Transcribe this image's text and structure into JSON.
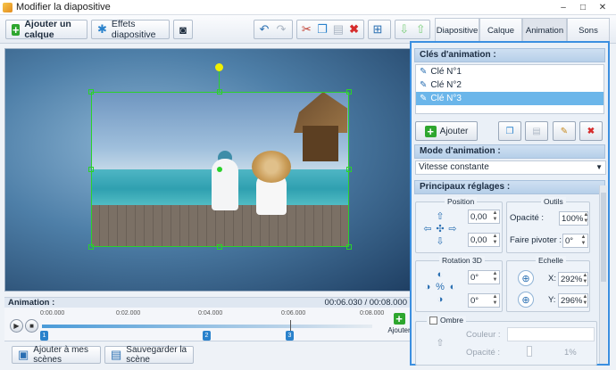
{
  "window": {
    "title": "Modifier la diapositive",
    "minimize": "–",
    "maximize": "□",
    "close": "✕"
  },
  "toolbar": {
    "add_layer": "Ajouter un calque",
    "slide_effects": "Effets diapositive"
  },
  "tabs": [
    "Diapositive",
    "Calque",
    "Animation",
    "Sons"
  ],
  "active_tab": "Animation",
  "timeline": {
    "section_label": "Animation :",
    "time_display": "00:06.030 / 00:08.000",
    "ticks": [
      "0:00.000",
      "0:02.000",
      "0:04.000",
      "0:06.000",
      "0:08.000"
    ],
    "keys": [
      "1",
      "2",
      "3"
    ],
    "add_label": "Ajouter"
  },
  "bottom": {
    "add_to_scenes": "Ajouter à mes scènes",
    "save_scene": "Sauvegarder la scène"
  },
  "panel": {
    "keyframes_title": "Clés d'animation :",
    "keyframes": [
      {
        "label": "Clé N°1",
        "selected": false
      },
      {
        "label": "Clé N°2",
        "selected": false
      },
      {
        "label": "Clé N°3",
        "selected": true
      }
    ],
    "add_button": "Ajouter",
    "mode_title": "Mode d'animation :",
    "mode_value": "Vitesse constante",
    "settings_title": "Principaux réglages :",
    "position_label": "Position",
    "position_x": "0,00",
    "position_y": "0,00",
    "tools_label": "Outils",
    "opacity_label": "Opacité :",
    "opacity_value": "100%",
    "rotate_label": "Faire pivoter :",
    "rotate_value": "0°",
    "rotation3d_label": "Rotation 3D",
    "rot3d_x": "0°",
    "rot3d_y": "0°",
    "scale_label": "Echelle",
    "scale_x_label": "X:",
    "scale_x": "292%",
    "scale_y_label": "Y:",
    "scale_y": "296%",
    "shadow_label": "Ombre",
    "shadow_color_label": "Couleur :",
    "shadow_opacity_label": "Opacité :",
    "shadow_opacity_value": "1%"
  },
  "colors": {
    "accent": "#3b8fe0",
    "selection": "#2bd12b",
    "rotation_handle": "#f0f000"
  }
}
